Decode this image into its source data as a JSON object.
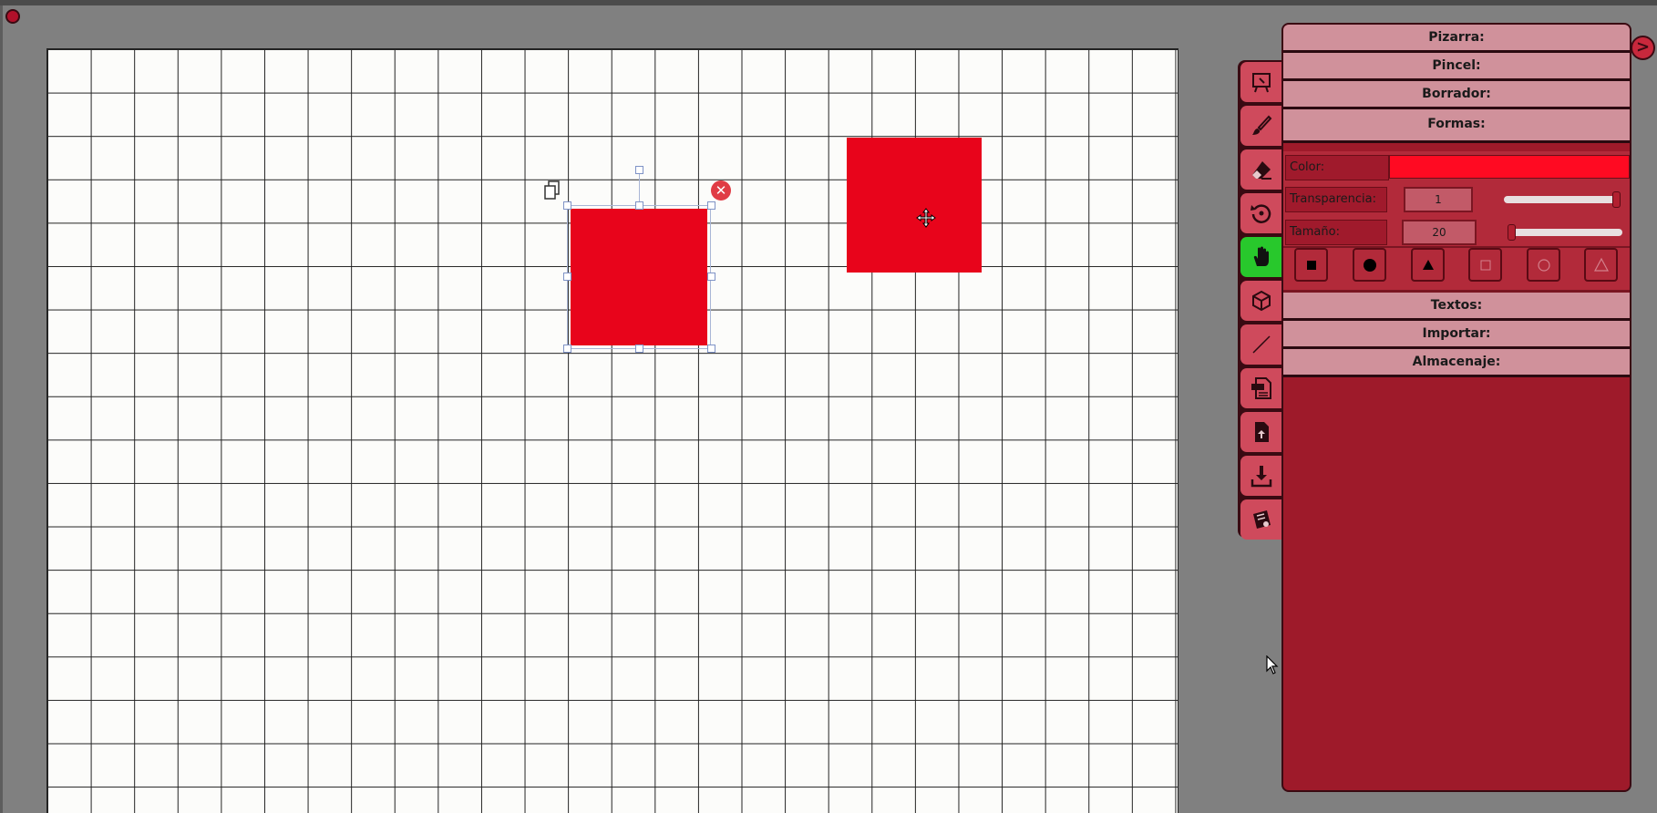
{
  "canvas": {
    "grid_color": "#222222",
    "background_color": "#fcfcfa",
    "shapes": [
      {
        "kind": "square",
        "color": "#e8041b",
        "selected": true
      },
      {
        "kind": "square",
        "color": "#e8041b",
        "selected": false
      }
    ],
    "selection_controls": {
      "delete_glyph": "✕",
      "clone_icon": "copy-icon"
    }
  },
  "toolbar": {
    "tools": [
      {
        "icon": "board-icon",
        "active": false
      },
      {
        "icon": "brush-icon",
        "active": false
      },
      {
        "icon": "eraser-icon",
        "active": false
      },
      {
        "icon": "reset-icon",
        "active": false
      },
      {
        "icon": "hand-icon",
        "active": true
      },
      {
        "icon": "cube-icon",
        "active": false
      },
      {
        "icon": "line-icon",
        "active": false
      },
      {
        "icon": "txt-file-icon",
        "active": false
      },
      {
        "icon": "import-file-icon",
        "active": false
      },
      {
        "icon": "download-icon",
        "active": false
      },
      {
        "icon": "storage-icon",
        "active": false
      }
    ],
    "active_color": "#28c82c"
  },
  "panel": {
    "expand_glyph": ">",
    "sections": {
      "pizarra": "Pizarra:",
      "pincel": "Pincel:",
      "borrador": "Borrador:",
      "formas": "Formas:",
      "textos": "Textos:",
      "importar": "Importar:",
      "almacenaje": "Almacenaje:"
    },
    "formas": {
      "color_label": "Color:",
      "color_value": "#ff0a22",
      "transparencia_label": "Transparencia:",
      "transparencia_value": "1",
      "transparencia_level": 1.0,
      "tamano_label": "Tamaño:",
      "tamano_value": "20",
      "tamano_level": 0.0,
      "shape_buttons": [
        "filled-square-icon",
        "filled-circle-icon",
        "filled-triangle-icon",
        "outline-square-icon",
        "outline-circle-icon",
        "outline-triangle-icon"
      ]
    }
  }
}
